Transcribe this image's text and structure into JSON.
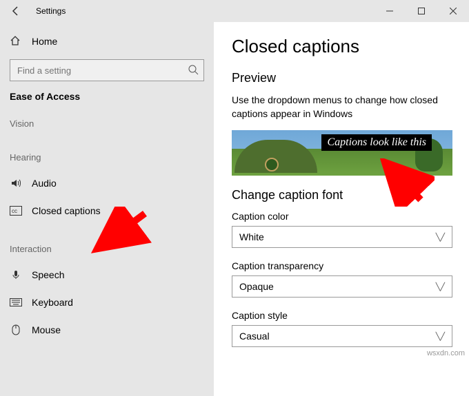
{
  "titlebar": {
    "title": "Settings"
  },
  "sidebar": {
    "home": "Home",
    "search_placeholder": "Find a setting",
    "group": "Ease of Access",
    "categories": {
      "vision": "Vision",
      "hearing": "Hearing",
      "interaction": "Interaction"
    },
    "items": {
      "audio": "Audio",
      "closed_captions": "Closed captions",
      "speech": "Speech",
      "keyboard": "Keyboard",
      "mouse": "Mouse"
    }
  },
  "content": {
    "heading": "Closed captions",
    "preview_heading": "Preview",
    "preview_desc": "Use the dropdown menus to change how closed captions appear in Windows",
    "caption_sample": "Captions look like this",
    "font_heading": "Change caption font",
    "fields": {
      "color_label": "Caption color",
      "color_value": "White",
      "transparency_label": "Caption transparency",
      "transparency_value": "Opaque",
      "style_label": "Caption style",
      "style_value": "Casual"
    }
  },
  "watermark": "wsxdn.com"
}
